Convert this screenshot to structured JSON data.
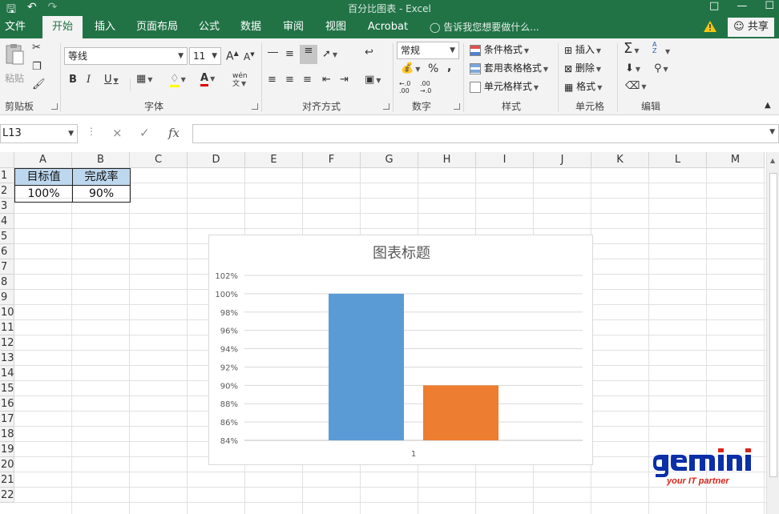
{
  "window": {
    "title": "百分比图表 - Excel"
  },
  "tabs": [
    "文件",
    "开始",
    "插入",
    "页面布局",
    "公式",
    "数据",
    "审阅",
    "视图",
    "Acrobat"
  ],
  "active_tab": "开始",
  "tell_me": "告诉我您想要做什么...",
  "share_label": "共享",
  "ribbon": {
    "clipboard": {
      "paste": "粘贴",
      "label": "剪贴板"
    },
    "font": {
      "name": "等线",
      "size": "11",
      "label": "字体",
      "bold": "B",
      "italic": "I",
      "underline": "U",
      "phonetic": "wén",
      "font_color_glyph": "A",
      "grow": "A",
      "shrink": "A"
    },
    "alignment": {
      "label": "对齐方式"
    },
    "number": {
      "format": "常规",
      "percent": "%",
      "comma": ",",
      "label": "数字",
      "inc_decimal": "←.0 .00",
      "dec_decimal": ".00 →.0"
    },
    "styles": {
      "conditional": "条件格式",
      "table": "套用表格格式",
      "cell": "单元格样式",
      "label": "样式"
    },
    "cells": {
      "insert": "插入",
      "delete": "删除",
      "format": "格式",
      "label": "单元格"
    },
    "editing": {
      "sum": "Σ",
      "sort": "A Z",
      "label": "编辑"
    }
  },
  "formula_bar": {
    "name_box": "L13",
    "cancel": "×",
    "enter": "✓",
    "fx": "fx",
    "value": ""
  },
  "columns": [
    "A",
    "B",
    "C",
    "D",
    "E",
    "F",
    "G",
    "H",
    "I",
    "J",
    "K",
    "L",
    "M"
  ],
  "rows": [
    "1",
    "2",
    "3",
    "4",
    "5",
    "6",
    "7",
    "8",
    "9",
    "10",
    "11",
    "12",
    "13",
    "14",
    "15",
    "16",
    "17",
    "18",
    "19",
    "20",
    "21",
    "22"
  ],
  "cells": {
    "A1": "目标值",
    "B1": "完成率",
    "A2": "100%",
    "B2": "90%"
  },
  "chart_data": {
    "type": "bar",
    "title": "图表标题",
    "categories": [
      "1"
    ],
    "series": [
      {
        "values": [
          1.0
        ],
        "color": "#5b9bd5"
      },
      {
        "values": [
          0.9
        ],
        "color": "#ed7d31"
      }
    ],
    "ylim": [
      0.84,
      1.02
    ],
    "yticks": [
      "84%",
      "86%",
      "88%",
      "90%",
      "92%",
      "94%",
      "96%",
      "98%",
      "100%",
      "102%"
    ],
    "grid": true,
    "legend": "none"
  },
  "watermark": {
    "brand": "gemini",
    "tagline": "your IT partner"
  },
  "colors": {
    "accent": "#217346",
    "header_fill": "#bdd7ee",
    "watermark_blue": "#0b2fa8",
    "watermark_red": "#d9241b"
  }
}
